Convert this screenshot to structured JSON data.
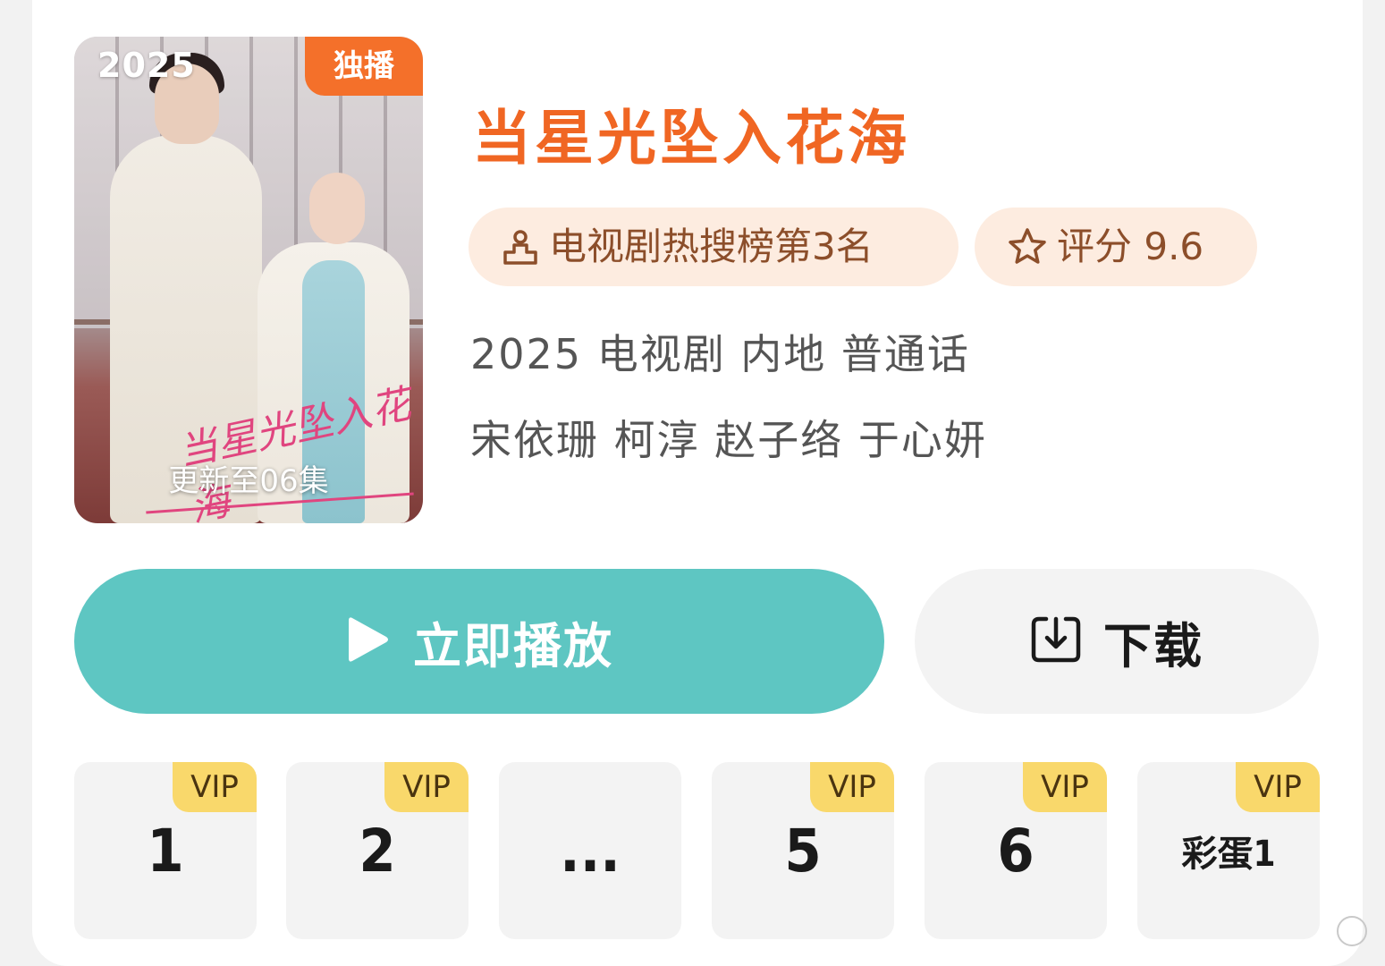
{
  "poster": {
    "year": "2025",
    "badge": "独播",
    "logo_text": "当星光坠入花海",
    "update_text": "更新至06集"
  },
  "show": {
    "title": "当星光坠入花海",
    "rank_tag": "电视剧热搜榜第3名",
    "score_tag": "评分 9.6",
    "meta": "2025 电视剧 内地 普通话",
    "cast": "宋依珊 柯淳 赵子络 于心妍"
  },
  "actions": {
    "play_label": "立即播放",
    "download_label": "下载"
  },
  "episodes": [
    {
      "label": "1",
      "vip": "VIP"
    },
    {
      "label": "2",
      "vip": "VIP"
    },
    {
      "label": "...",
      "vip": ""
    },
    {
      "label": "5",
      "vip": "VIP"
    },
    {
      "label": "6",
      "vip": "VIP"
    },
    {
      "label": "彩蛋1",
      "vip": "VIP"
    }
  ],
  "colors": {
    "accent": "#f06623",
    "play_button": "#5ec6c2",
    "vip_badge": "#f9d86b",
    "tag_bg": "#fdece0"
  },
  "icons": {
    "rank": "podium-icon",
    "score": "star-icon",
    "play": "play-icon",
    "download": "download-icon"
  }
}
